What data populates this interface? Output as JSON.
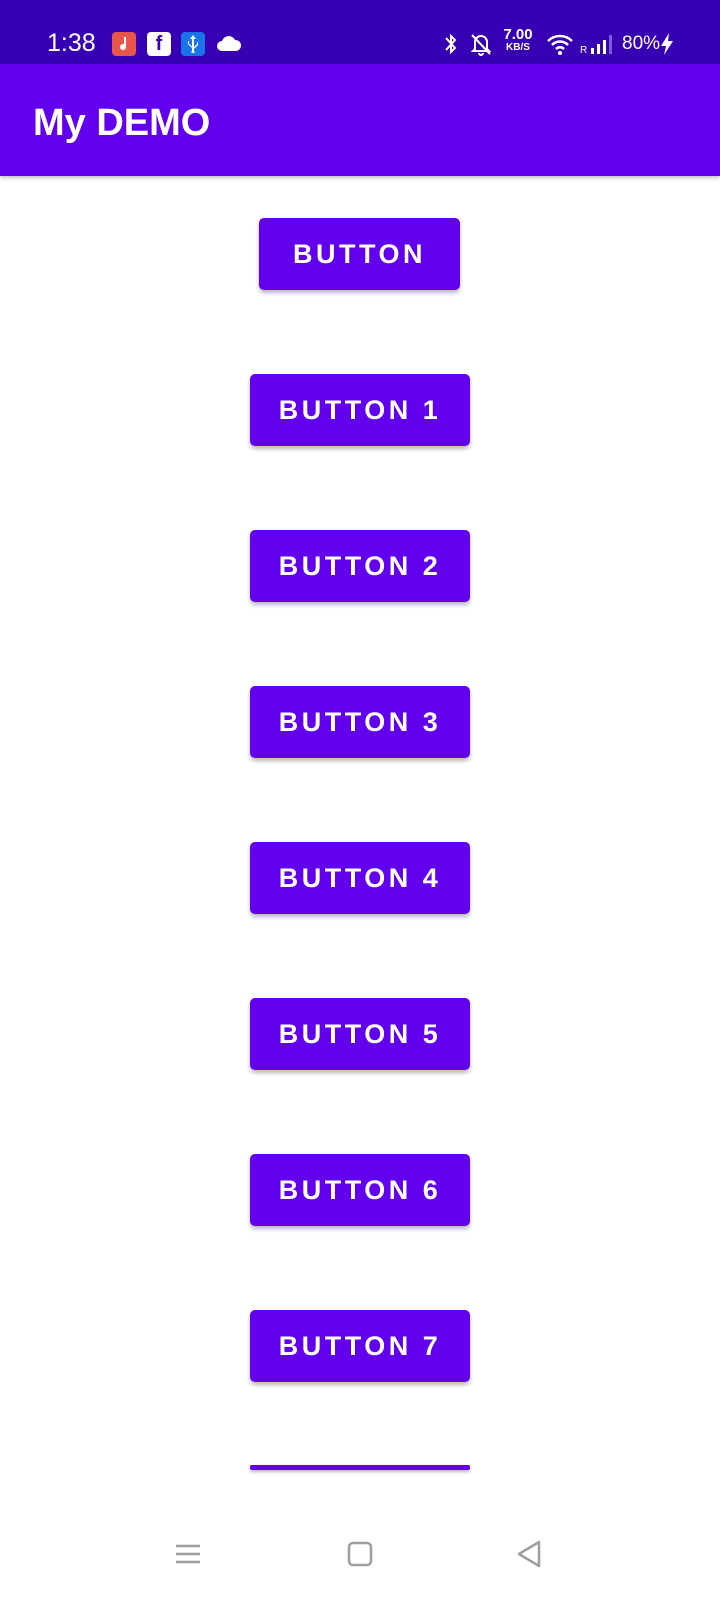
{
  "status_bar": {
    "time": "1:38",
    "net_speed_value": "7.00",
    "net_speed_unit": "KB/S",
    "battery": "80%",
    "icons": [
      "music-icon",
      "facebook-icon",
      "usb-icon",
      "cloud-icon",
      "bluetooth-icon",
      "bell-off-icon",
      "wifi-icon",
      "signal-icon",
      "charging-icon"
    ],
    "fb_glyph": "f"
  },
  "app_bar": {
    "title": "My DEMO"
  },
  "buttons": {
    "main": "BUTTON",
    "b1": "BUTTON 1",
    "b2": "BUTTON 2",
    "b3": "BUTTON 3",
    "b4": "BUTTON 4",
    "b5": "BUTTON 5",
    "b6": "BUTTON 6",
    "b7": "BUTTON 7"
  },
  "nav_bar": {
    "icons": [
      "menu-icon",
      "home-icon",
      "back-icon"
    ]
  },
  "colors": {
    "status_bar": "#3700b3",
    "primary": "#6200ee",
    "button_text": "#ffffff"
  }
}
